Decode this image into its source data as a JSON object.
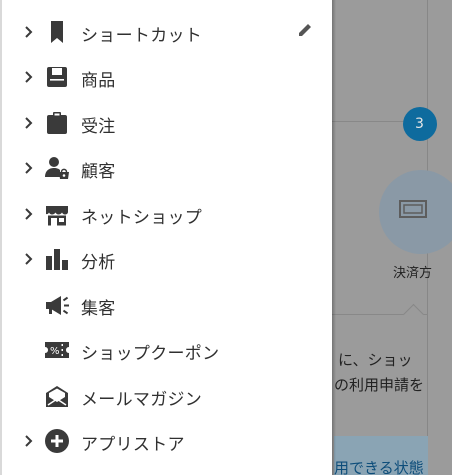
{
  "background": {
    "badge": "3",
    "payment_label": "決済方",
    "text_line1": "に、ショッ",
    "text_line2": "の利用申請を",
    "text_line3": "用できる状態"
  },
  "menu": {
    "items": [
      {
        "label": "ショートカット",
        "icon": "bookmark-icon",
        "has_chevron": true
      },
      {
        "label": "商品",
        "icon": "product-icon",
        "has_chevron": true
      },
      {
        "label": "受注",
        "icon": "clipboard-icon",
        "has_chevron": true
      },
      {
        "label": "顧客",
        "icon": "customer-icon",
        "has_chevron": true
      },
      {
        "label": "ネットショップ",
        "icon": "store-icon",
        "has_chevron": true
      },
      {
        "label": "分析",
        "icon": "bar-chart-icon",
        "has_chevron": true
      },
      {
        "label": "集客",
        "icon": "megaphone-icon",
        "has_chevron": false
      },
      {
        "label": "ショップクーポン",
        "icon": "coupon-icon",
        "has_chevron": false
      },
      {
        "label": "メールマガジン",
        "icon": "mail-icon",
        "has_chevron": false
      },
      {
        "label": "アプリストア",
        "icon": "add-circle-icon",
        "has_chevron": true
      }
    ]
  },
  "colors": {
    "icon": "#3a3a3a",
    "text": "#303030",
    "overlay": "#9b9b9b"
  }
}
